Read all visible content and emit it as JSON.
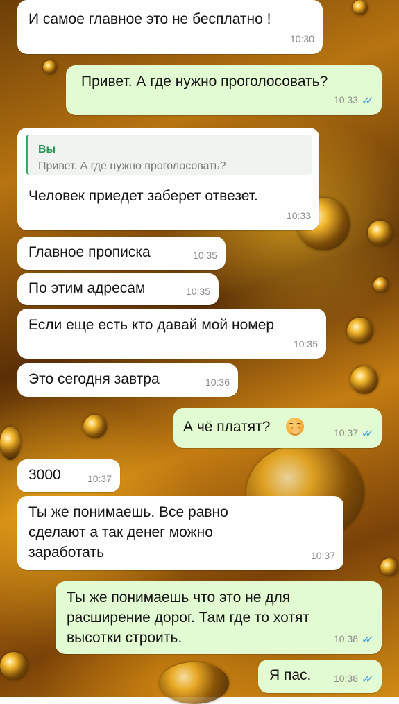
{
  "messages": [
    {
      "dir": "in",
      "text": "И самое главное это не бесплатно !",
      "time": "10:30"
    },
    {
      "dir": "out",
      "text": "Привет. А где нужно проголосовать?",
      "time": "10:33",
      "status": "read"
    },
    {
      "dir": "in",
      "quote": {
        "author": "Вы",
        "text": "Привет. А где нужно проголосовать?"
      },
      "text": "Человек приедет заберет отвезет.",
      "time": "10:33"
    },
    {
      "dir": "in",
      "text": "Главное прописка",
      "time": "10:35"
    },
    {
      "dir": "in",
      "text": "По этим адресам",
      "time": "10:35"
    },
    {
      "dir": "in",
      "text": "Если еще есть кто давай мой номер",
      "time": "10:35"
    },
    {
      "dir": "in",
      "text": "Это сегодня завтра",
      "time": "10:36"
    },
    {
      "dir": "out",
      "text": "А чё платят?",
      "emoji": "hand-over-mouth-face",
      "time": "10:37",
      "status": "read"
    },
    {
      "dir": "in",
      "text": "3000",
      "time": "10:37"
    },
    {
      "dir": "in",
      "text": "Ты же понимаешь. Все равно\nсделают а так денег можно\nзаработать",
      "time": "10:37"
    },
    {
      "dir": "out",
      "text": "Ты же понимаешь что это не для\nрасширение дорог. Там где то хотят\nвысотки строить.",
      "time": "10:38",
      "status": "read"
    },
    {
      "dir": "out",
      "text": "Я пас.",
      "time": "10:38",
      "status": "read"
    }
  ],
  "read_ticks": "✓✓",
  "colors": {
    "incoming": "#ffffff",
    "outgoing": "#e3fbd2",
    "ticks": "#3d9be0",
    "quote_author": "#2e9457"
  }
}
